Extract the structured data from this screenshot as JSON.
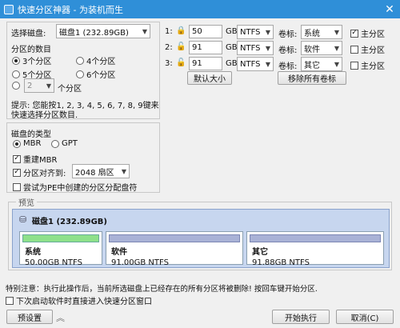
{
  "window": {
    "title": "快速分区神器 - 为装机而生",
    "close_glyph": "✕"
  },
  "disk_select": {
    "label": "选择磁盘:",
    "value": "磁盘1 (232.89GB)"
  },
  "partition_count": {
    "label": "分区的数目",
    "options": [
      "3个分区",
      "4个分区",
      "5个分区",
      "6个分区"
    ],
    "selected": "3个分区",
    "custom_value": "2",
    "custom_label": "个分区"
  },
  "hint": {
    "line1": "提示: 您能按1, 2, 3, 4, 5, 6, 7, 8, 9键来",
    "line2": "快速选择分区数目."
  },
  "disk_type": {
    "label": "磁盘的类型",
    "mbr": "MBR",
    "gpt": "GPT",
    "rebuild_mbr": "重建MBR",
    "align_label": "分区对齐到:",
    "align_value": "2048 扇区",
    "pe_assign": "尝试为PE中创建的分区分配盘符"
  },
  "partitions": [
    {
      "index": "1:",
      "size": "50",
      "unit": "GB",
      "fs": "NTFS",
      "label_caption": "卷标:",
      "label": "系统",
      "primary": "主分区",
      "primary_checked": true
    },
    {
      "index": "2:",
      "size": "91",
      "unit": "GB",
      "fs": "NTFS",
      "label_caption": "卷标:",
      "label": "软件",
      "primary": "主分区",
      "primary_checked": false
    },
    {
      "index": "3:",
      "size": "91",
      "unit": "GB",
      "fs": "NTFS",
      "label_caption": "卷标:",
      "label": "其它",
      "primary": "主分区",
      "primary_checked": false
    }
  ],
  "buttons": {
    "default_size": "默认大小",
    "remove_labels": "移除所有卷标",
    "preset": "预设置",
    "start": "开始执行",
    "cancel": "取消(C)"
  },
  "preview": {
    "legend": "预览",
    "disk_name": "磁盘1 (232.89GB)",
    "parts": [
      {
        "name": "系统",
        "detail": "50.00GB NTFS",
        "bar_color": "#8ee08a"
      },
      {
        "name": "软件",
        "detail": "91.00GB NTFS",
        "bar_color": "#a9b2d6"
      },
      {
        "name": "其它",
        "detail": "91.88GB NTFS",
        "bar_color": "#a9b2d6"
      }
    ]
  },
  "warning": "特别注意：执行此操作后，当前所选磁盘上已经存在的所有分区将被删除! 按回车键开始分区.",
  "auto_start": "下次启动软件时直接进入快速分区窗口",
  "expand_glyph": "︽",
  "accent": "#2f8fd8"
}
